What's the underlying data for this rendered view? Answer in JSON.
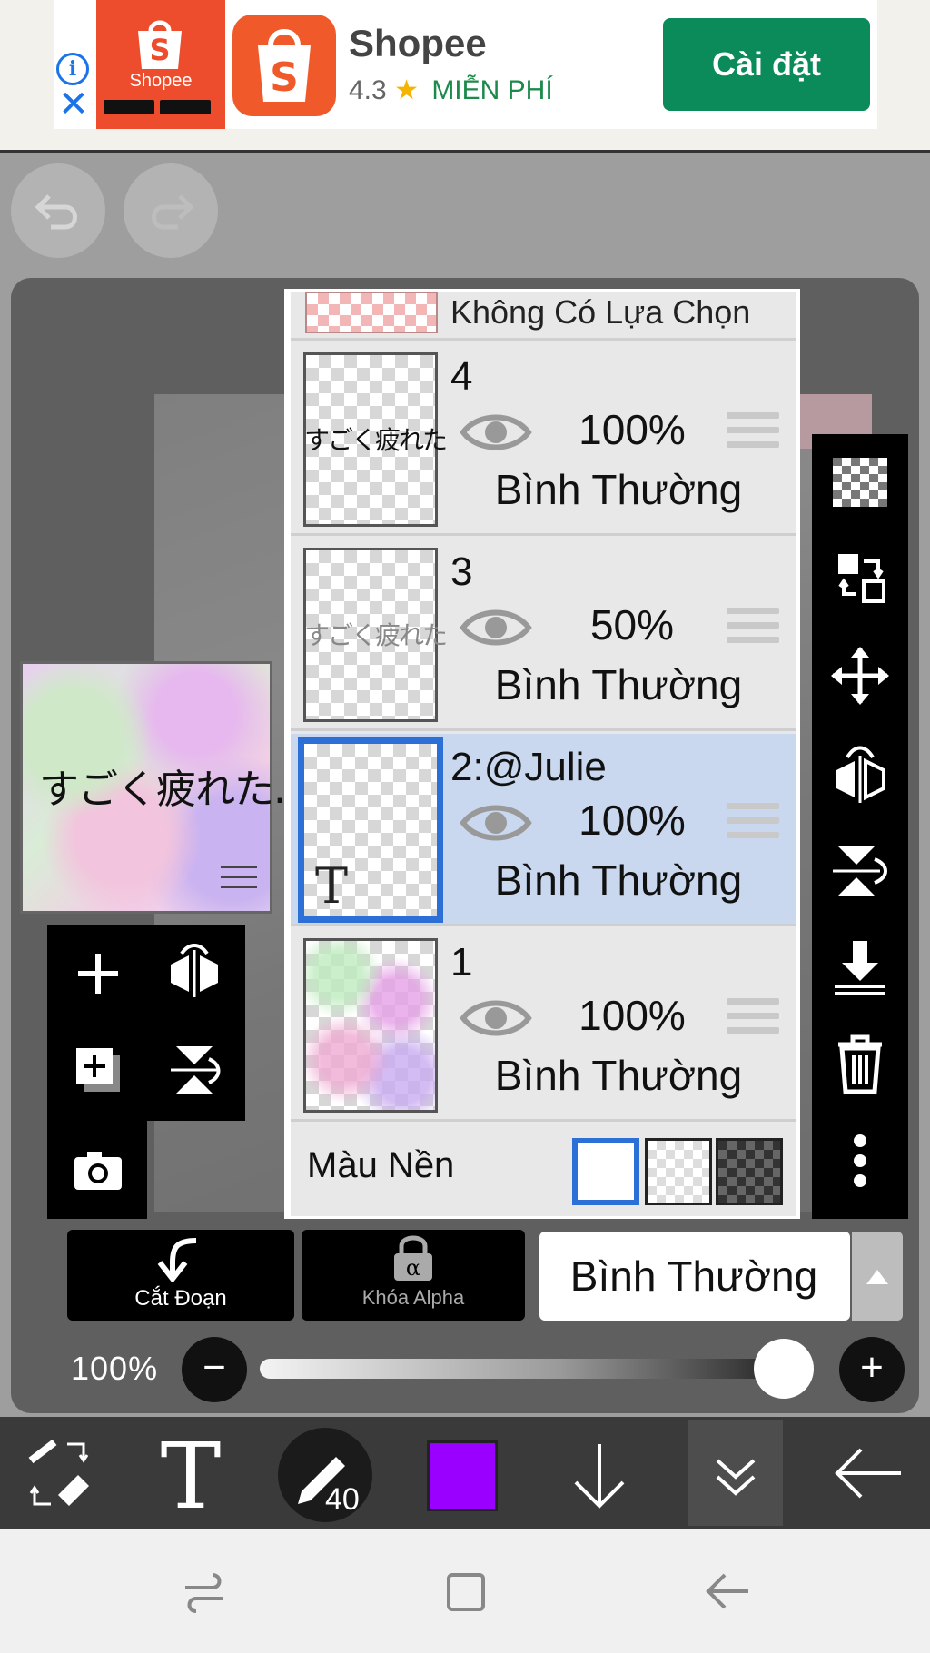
{
  "ad": {
    "tile_brand": "Shopee",
    "app_name": "Shopee",
    "rating": "4.3",
    "star": "★",
    "price": "MIỄN PHÍ",
    "install_label": "Cài đặt",
    "info_icon": "i",
    "close_icon": "✕",
    "brand_color": "#ee4d2d",
    "install_color": "#0b8a5a"
  },
  "layers_panel": {
    "selection_label": "Không Có Lựa Chọn",
    "layers": [
      {
        "name": "4",
        "opacity": "100%",
        "blend": "Bình Thường",
        "thumb_text": "すごく疲れた"
      },
      {
        "name": "3",
        "opacity": "50%",
        "blend": "Bình Thường",
        "thumb_text": "すごく疲れた"
      },
      {
        "name": "2:@Julie",
        "opacity": "100%",
        "blend": "Bình Thường",
        "thumb_glyph": "T"
      },
      {
        "name": "1",
        "opacity": "100%",
        "blend": "Bình Thường"
      }
    ],
    "active_layer": "2:@Julie",
    "background_label": "Màu Nền",
    "background_options": [
      "white",
      "transparent",
      "dark"
    ],
    "background_selected": "white"
  },
  "canvas": {
    "thumb_text": "すごく疲れた..."
  },
  "controls": {
    "clip_label": "Cắt Đoạn",
    "alpha_label": "Khóa Alpha",
    "alpha_glyph": "α",
    "blend_mode": "Bình Thường",
    "opacity_label": "100%",
    "opacity_value": 1.0,
    "minus": "−",
    "plus": "+"
  },
  "toolbar": {
    "text_tool_glyph": "T",
    "brush_size": "40",
    "current_color": "#9900ff"
  },
  "colors": {
    "accent": "#2c6fd6",
    "active_layer_bg": "#c9d8ee"
  }
}
